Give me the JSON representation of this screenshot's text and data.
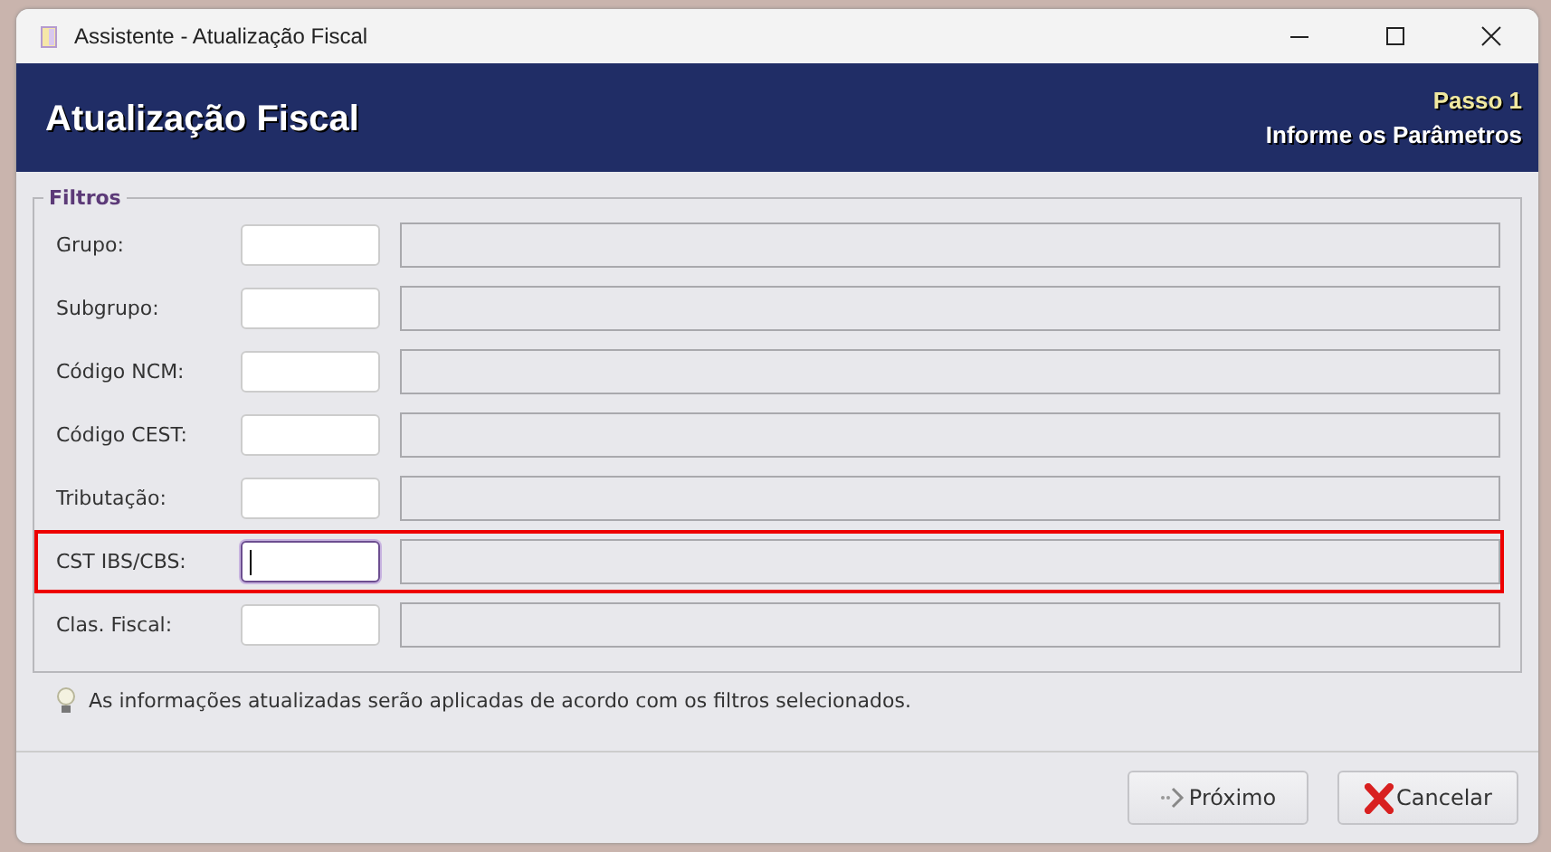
{
  "window": {
    "title": "Assistente - Atualização Fiscal"
  },
  "header": {
    "title": "Atualização Fiscal",
    "step": "Passo 1",
    "subtitle": "Informe os Parâmetros"
  },
  "filters": {
    "legend": "Filtros",
    "rows": [
      {
        "label": "Grupo:",
        "focused": false,
        "highlighted": false
      },
      {
        "label": "Subgrupo:",
        "focused": false,
        "highlighted": false
      },
      {
        "label": "Código NCM:",
        "focused": false,
        "highlighted": false
      },
      {
        "label": "Código CEST:",
        "focused": false,
        "highlighted": false
      },
      {
        "label": "Tributação:",
        "focused": false,
        "highlighted": false
      },
      {
        "label": "CST IBS/CBS:",
        "focused": true,
        "highlighted": true
      },
      {
        "label": "Clas. Fiscal:",
        "focused": false,
        "highlighted": false
      }
    ]
  },
  "hint": "As informações atualizadas serão aplicadas de acordo com os filtros selecionados.",
  "buttons": [
    {
      "label": "Próximo",
      "kind": "next"
    },
    {
      "label": "Cancelar",
      "kind": "cancel"
    }
  ]
}
